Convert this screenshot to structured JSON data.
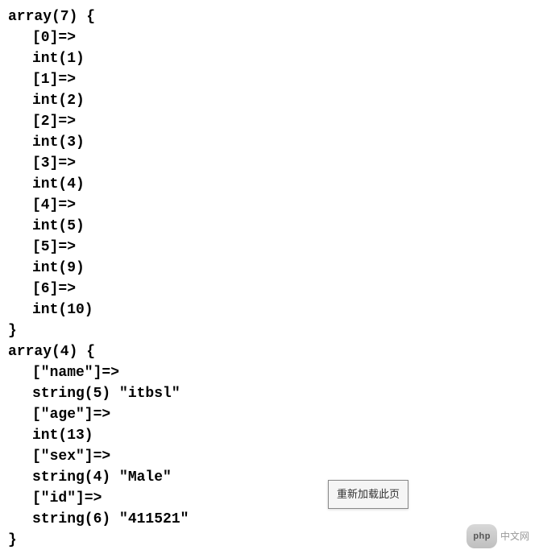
{
  "array1": {
    "header": "array(7) {",
    "lines": [
      "[0]=>",
      "int(1)",
      "[1]=>",
      "int(2)",
      "[2]=>",
      "int(3)",
      "[3]=>",
      "int(4)",
      "[4]=>",
      "int(5)",
      "[5]=>",
      "int(9)",
      "[6]=>",
      "int(10)"
    ],
    "footer": "}"
  },
  "array2": {
    "header": "array(4) {",
    "lines": [
      "[\"name\"]=>",
      "string(5) \"itbsl\"",
      "[\"age\"]=>",
      "int(13)",
      "[\"sex\"]=>",
      "string(4) \"Male\"",
      "[\"id\"]=>",
      "string(6) \"411521\""
    ],
    "footer": "}"
  },
  "tooltip": {
    "text": "重新加载此页"
  },
  "watermark": {
    "pill": "php",
    "text": "中文网"
  }
}
